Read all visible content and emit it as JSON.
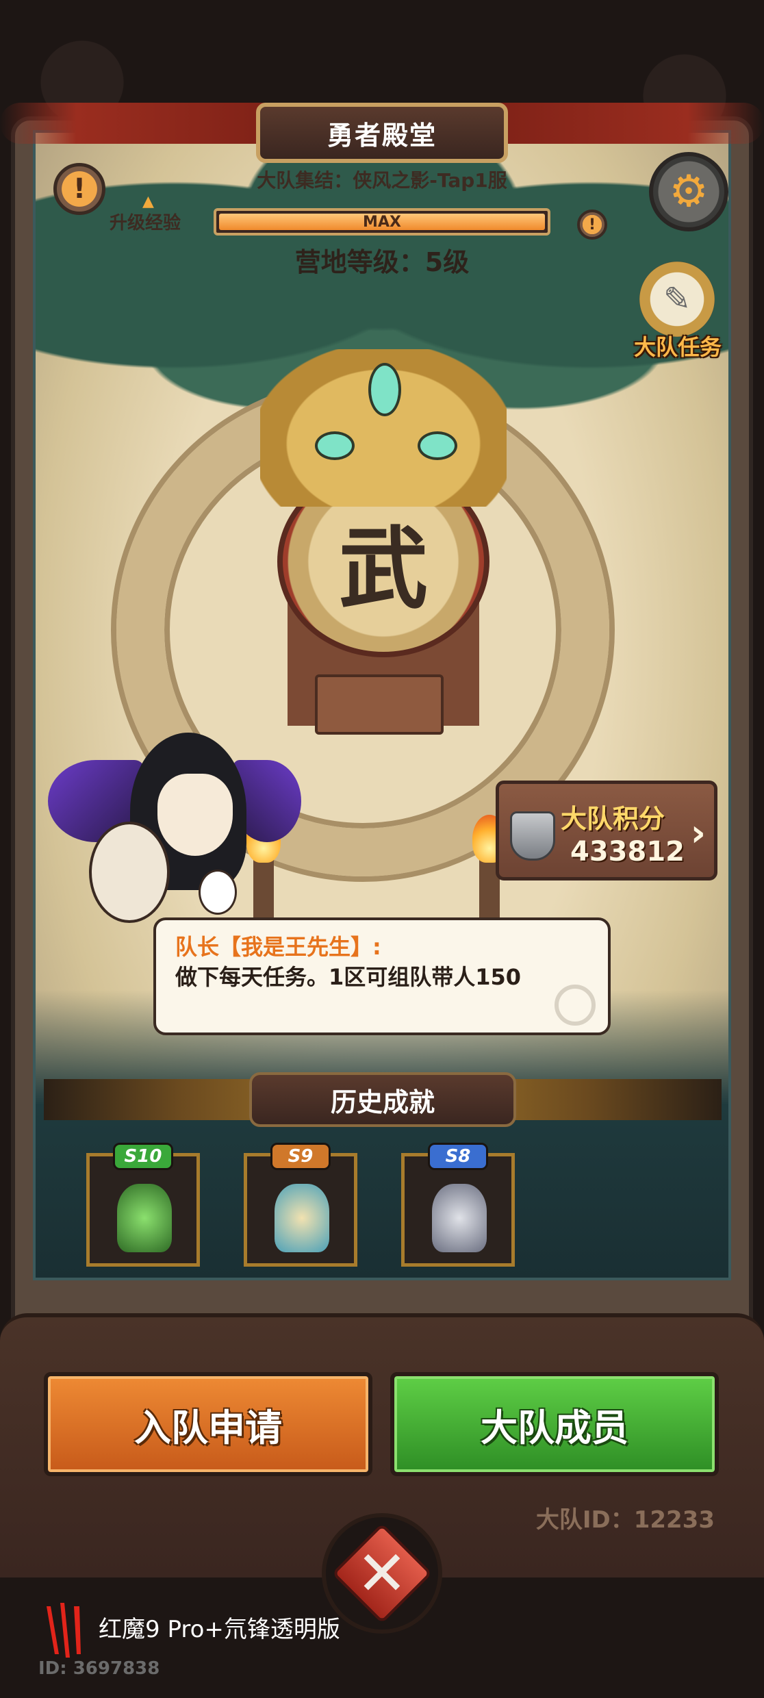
{
  "header": {
    "title": "勇者殿堂",
    "subtitle": "大队集结：侠风之影-Tap1服",
    "exp_label": "升级经验",
    "exp_bar_text": "MAX",
    "exp_progress": 1.0,
    "camp_level": "营地等级：5级",
    "info_glyph": "!",
    "settings_icon": "gear-icon"
  },
  "side": {
    "task_label": "大队任务"
  },
  "arena": {
    "drum_char": "武"
  },
  "points": {
    "label": "大队积分",
    "value": "433812",
    "chevron": "›"
  },
  "chat": {
    "speaker": "队长【我是王先生】:",
    "message": "做下每天任务。1区可组队带人150"
  },
  "achievements": {
    "title": "历史成就",
    "items": [
      {
        "season": "S10",
        "badge_color": "#3aa83a"
      },
      {
        "season": "S9",
        "badge_color": "#d0782a"
      },
      {
        "season": "S8",
        "badge_color": "#3a6ed0"
      }
    ]
  },
  "actions": {
    "join_label": "入队申请",
    "members_label": "大队成员",
    "team_id": "大队ID：12233",
    "close_glyph": "✕"
  },
  "watermark": {
    "device": "红魔9 Pro+氘锋透明版",
    "id": "ID: 3697838"
  },
  "colors": {
    "accent_orange": "#ee8a34",
    "accent_green": "#5fcf46",
    "gold": "#c8a062"
  }
}
